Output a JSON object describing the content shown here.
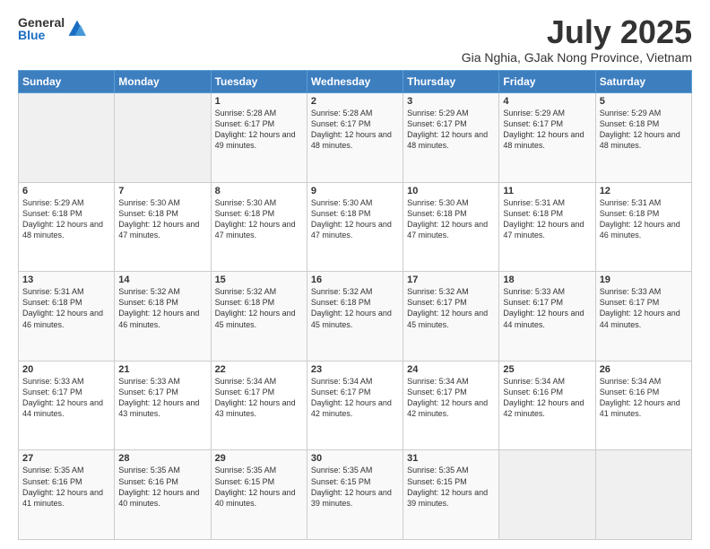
{
  "header": {
    "logo_general": "General",
    "logo_blue": "Blue",
    "month_title": "July 2025",
    "location": "Gia Nghia, GJak Nong Province, Vietnam"
  },
  "days_of_week": [
    "Sunday",
    "Monday",
    "Tuesday",
    "Wednesday",
    "Thursday",
    "Friday",
    "Saturday"
  ],
  "weeks": [
    [
      {
        "day": "",
        "info": ""
      },
      {
        "day": "",
        "info": ""
      },
      {
        "day": "1",
        "info": "Sunrise: 5:28 AM\nSunset: 6:17 PM\nDaylight: 12 hours and 49 minutes."
      },
      {
        "day": "2",
        "info": "Sunrise: 5:28 AM\nSunset: 6:17 PM\nDaylight: 12 hours and 48 minutes."
      },
      {
        "day": "3",
        "info": "Sunrise: 5:29 AM\nSunset: 6:17 PM\nDaylight: 12 hours and 48 minutes."
      },
      {
        "day": "4",
        "info": "Sunrise: 5:29 AM\nSunset: 6:17 PM\nDaylight: 12 hours and 48 minutes."
      },
      {
        "day": "5",
        "info": "Sunrise: 5:29 AM\nSunset: 6:18 PM\nDaylight: 12 hours and 48 minutes."
      }
    ],
    [
      {
        "day": "6",
        "info": "Sunrise: 5:29 AM\nSunset: 6:18 PM\nDaylight: 12 hours and 48 minutes."
      },
      {
        "day": "7",
        "info": "Sunrise: 5:30 AM\nSunset: 6:18 PM\nDaylight: 12 hours and 47 minutes."
      },
      {
        "day": "8",
        "info": "Sunrise: 5:30 AM\nSunset: 6:18 PM\nDaylight: 12 hours and 47 minutes."
      },
      {
        "day": "9",
        "info": "Sunrise: 5:30 AM\nSunset: 6:18 PM\nDaylight: 12 hours and 47 minutes."
      },
      {
        "day": "10",
        "info": "Sunrise: 5:30 AM\nSunset: 6:18 PM\nDaylight: 12 hours and 47 minutes."
      },
      {
        "day": "11",
        "info": "Sunrise: 5:31 AM\nSunset: 6:18 PM\nDaylight: 12 hours and 47 minutes."
      },
      {
        "day": "12",
        "info": "Sunrise: 5:31 AM\nSunset: 6:18 PM\nDaylight: 12 hours and 46 minutes."
      }
    ],
    [
      {
        "day": "13",
        "info": "Sunrise: 5:31 AM\nSunset: 6:18 PM\nDaylight: 12 hours and 46 minutes."
      },
      {
        "day": "14",
        "info": "Sunrise: 5:32 AM\nSunset: 6:18 PM\nDaylight: 12 hours and 46 minutes."
      },
      {
        "day": "15",
        "info": "Sunrise: 5:32 AM\nSunset: 6:18 PM\nDaylight: 12 hours and 45 minutes."
      },
      {
        "day": "16",
        "info": "Sunrise: 5:32 AM\nSunset: 6:18 PM\nDaylight: 12 hours and 45 minutes."
      },
      {
        "day": "17",
        "info": "Sunrise: 5:32 AM\nSunset: 6:17 PM\nDaylight: 12 hours and 45 minutes."
      },
      {
        "day": "18",
        "info": "Sunrise: 5:33 AM\nSunset: 6:17 PM\nDaylight: 12 hours and 44 minutes."
      },
      {
        "day": "19",
        "info": "Sunrise: 5:33 AM\nSunset: 6:17 PM\nDaylight: 12 hours and 44 minutes."
      }
    ],
    [
      {
        "day": "20",
        "info": "Sunrise: 5:33 AM\nSunset: 6:17 PM\nDaylight: 12 hours and 44 minutes."
      },
      {
        "day": "21",
        "info": "Sunrise: 5:33 AM\nSunset: 6:17 PM\nDaylight: 12 hours and 43 minutes."
      },
      {
        "day": "22",
        "info": "Sunrise: 5:34 AM\nSunset: 6:17 PM\nDaylight: 12 hours and 43 minutes."
      },
      {
        "day": "23",
        "info": "Sunrise: 5:34 AM\nSunset: 6:17 PM\nDaylight: 12 hours and 42 minutes."
      },
      {
        "day": "24",
        "info": "Sunrise: 5:34 AM\nSunset: 6:17 PM\nDaylight: 12 hours and 42 minutes."
      },
      {
        "day": "25",
        "info": "Sunrise: 5:34 AM\nSunset: 6:16 PM\nDaylight: 12 hours and 42 minutes."
      },
      {
        "day": "26",
        "info": "Sunrise: 5:34 AM\nSunset: 6:16 PM\nDaylight: 12 hours and 41 minutes."
      }
    ],
    [
      {
        "day": "27",
        "info": "Sunrise: 5:35 AM\nSunset: 6:16 PM\nDaylight: 12 hours and 41 minutes."
      },
      {
        "day": "28",
        "info": "Sunrise: 5:35 AM\nSunset: 6:16 PM\nDaylight: 12 hours and 40 minutes."
      },
      {
        "day": "29",
        "info": "Sunrise: 5:35 AM\nSunset: 6:15 PM\nDaylight: 12 hours and 40 minutes."
      },
      {
        "day": "30",
        "info": "Sunrise: 5:35 AM\nSunset: 6:15 PM\nDaylight: 12 hours and 39 minutes."
      },
      {
        "day": "31",
        "info": "Sunrise: 5:35 AM\nSunset: 6:15 PM\nDaylight: 12 hours and 39 minutes."
      },
      {
        "day": "",
        "info": ""
      },
      {
        "day": "",
        "info": ""
      }
    ]
  ]
}
